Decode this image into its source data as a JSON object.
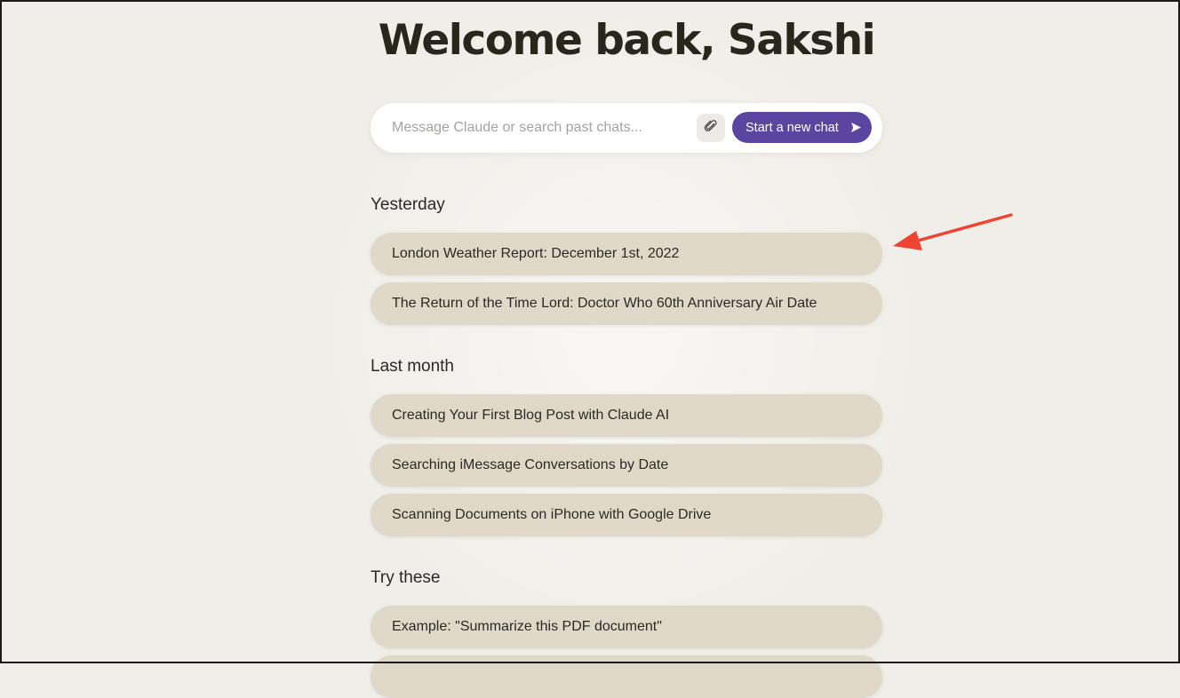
{
  "welcome": {
    "title": "Welcome back, Sakshi"
  },
  "search": {
    "placeholder": "Message Claude or search past chats...",
    "start_label": "Start a new chat"
  },
  "sections": {
    "yesterday": {
      "label": "Yesterday",
      "items": [
        "London Weather Report: December 1st, 2022",
        "The Return of the Time Lord: Doctor Who 60th Anniversary Air Date"
      ]
    },
    "last_month": {
      "label": "Last month",
      "items": [
        "Creating Your First Blog Post with Claude AI",
        "Searching iMessage Conversations by Date",
        "Scanning Documents on iPhone with Google Drive"
      ]
    },
    "try_these": {
      "label": "Try these",
      "items": [
        "Example: \"Summarize this PDF document\""
      ]
    }
  },
  "colors": {
    "background": "#f0eee8",
    "accent": "#5c45a0",
    "chat_item": "#e0d8c8",
    "annotation_arrow": "#ee4433"
  },
  "icons": {
    "attach": "paperclip-icon",
    "send": "send-icon",
    "annotation": "red-arrow-annotation"
  }
}
